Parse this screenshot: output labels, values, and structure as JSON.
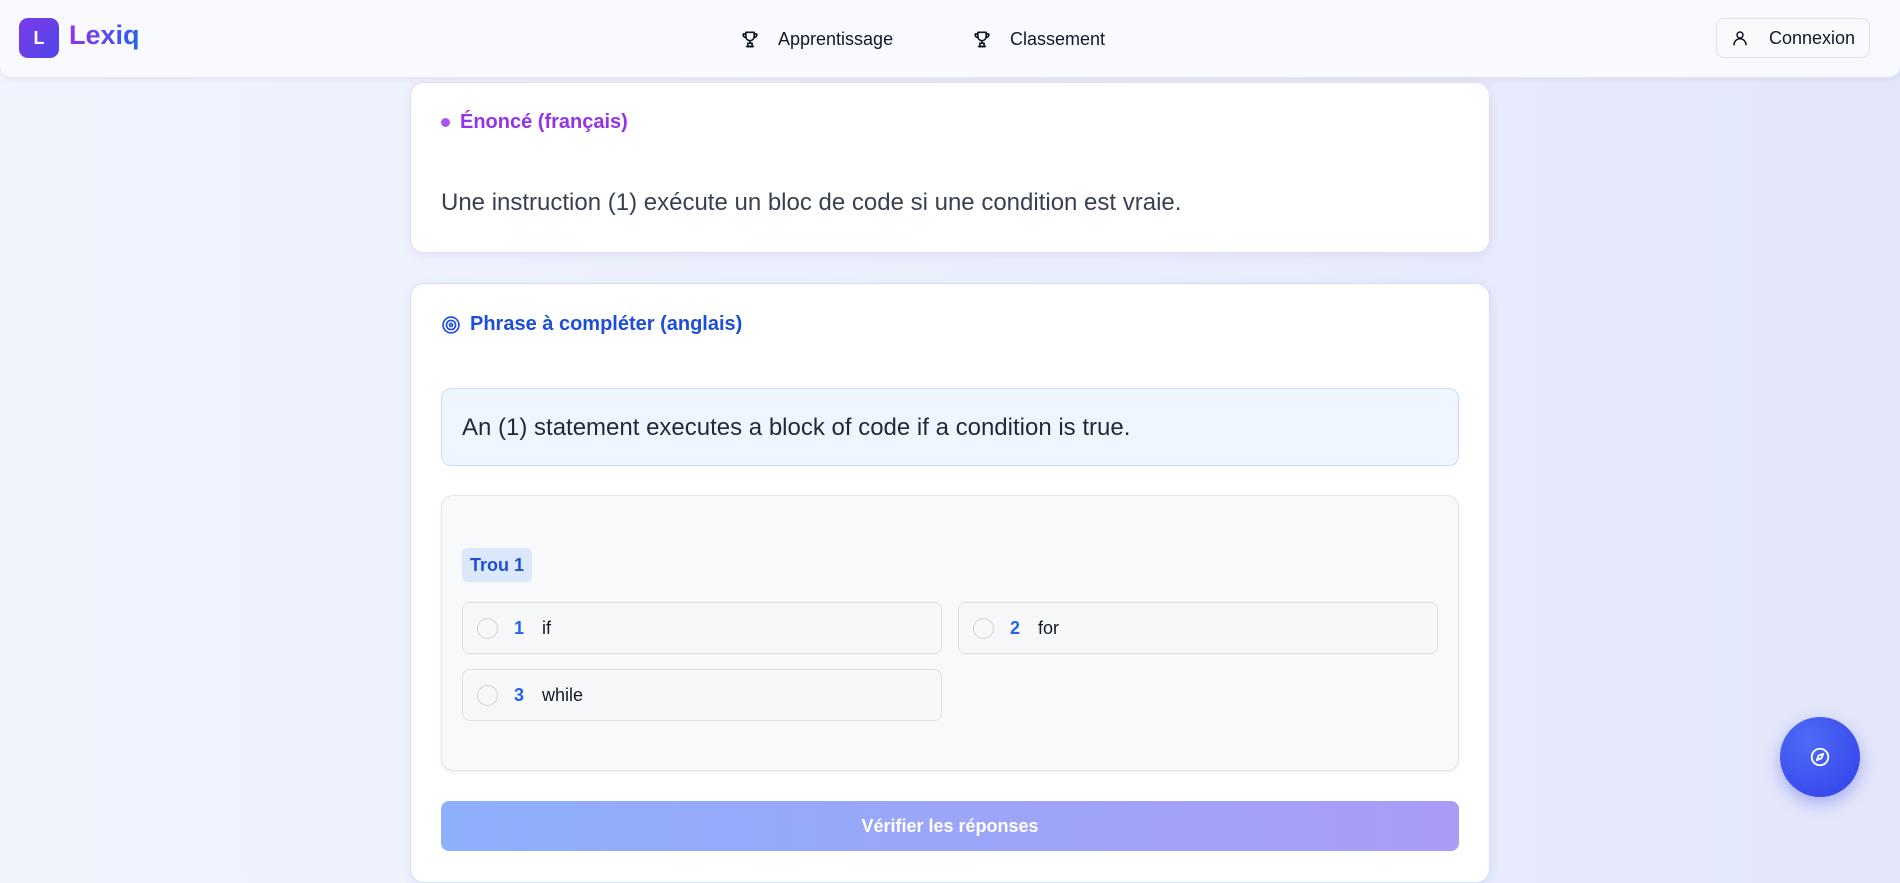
{
  "brand": {
    "logo_letter": "L",
    "name": "Lexiq"
  },
  "nav": {
    "items": [
      {
        "label": "Apprentissage",
        "icon": "trophy-icon"
      },
      {
        "label": "Classement",
        "icon": "trophy-icon"
      }
    ],
    "login_label": "Connexion",
    "login_icon": "user-icon"
  },
  "statement_card": {
    "title": "Énoncé (français)",
    "text": "Une instruction (1) exécute un bloc de code si une condition est vraie."
  },
  "exercise_card": {
    "title": "Phrase à compléter (anglais)",
    "title_icon": "target-icon",
    "sentence": "An (1) statement executes a block of code if a condition is true.",
    "blank": {
      "label": "Trou 1",
      "options": [
        {
          "number": "1",
          "text": "if"
        },
        {
          "number": "2",
          "text": "for"
        },
        {
          "number": "3",
          "text": "while"
        }
      ]
    },
    "verify_label": "Vérifier les réponses"
  },
  "fab": {
    "icon": "compass-icon"
  },
  "colors": {
    "brand_purple": "#9333ea",
    "brand_blue": "#1d4ed8",
    "fab_blue": "#2f3fe8"
  }
}
